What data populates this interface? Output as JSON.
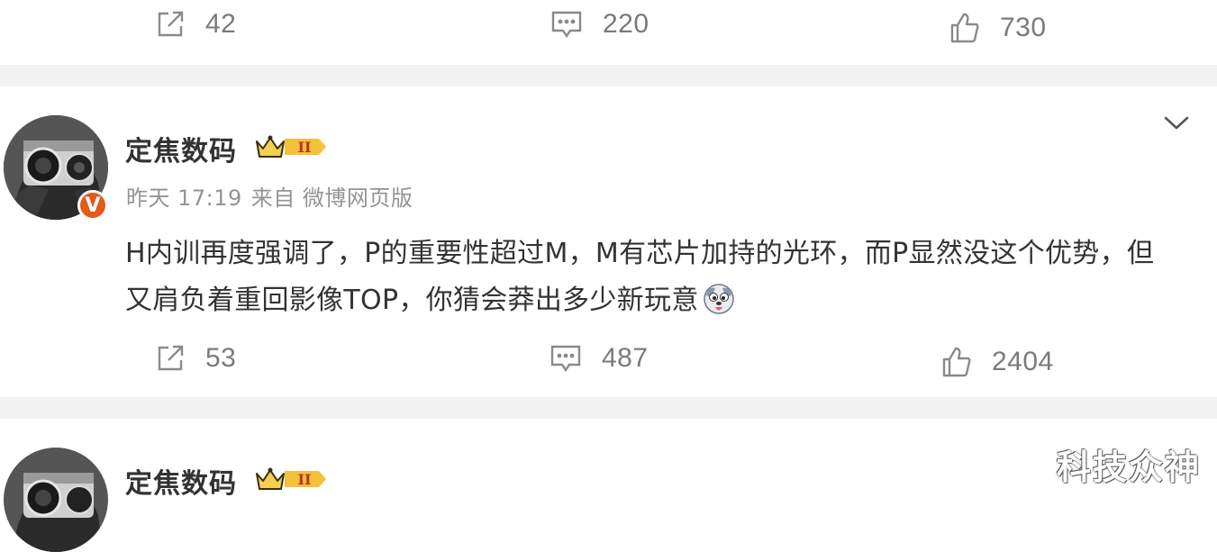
{
  "posts": [
    {
      "actions": {
        "share_count": "42",
        "comment_count": "220",
        "like_count": "730"
      }
    },
    {
      "author": "定焦数码",
      "level_badge": "II",
      "verified_mark": "V",
      "meta": {
        "time": "昨天 17:19",
        "source": "来自 微博网页版"
      },
      "text": "H内训再度强调了，P的重要性超过M，M有芯片加持的光环，而P显然没这个优势，但又肩负着重回影像TOP，你猜会莽出多少新玩意",
      "emoji": "dog-tongue-emoji",
      "actions": {
        "share_count": "53",
        "comment_count": "487",
        "like_count": "2404"
      }
    },
    {
      "author": "定焦数码",
      "level_badge": "II"
    }
  ],
  "watermark": "科技众神",
  "icons": [
    "share-icon",
    "comment-icon",
    "like-icon",
    "chevron-down-icon",
    "crown-badge-icon"
  ],
  "colors": {
    "text": "#333333",
    "muted": "#939393",
    "separator": "#f2f2f2",
    "badge": "#e45a1b",
    "crown": "#f3c13a"
  }
}
